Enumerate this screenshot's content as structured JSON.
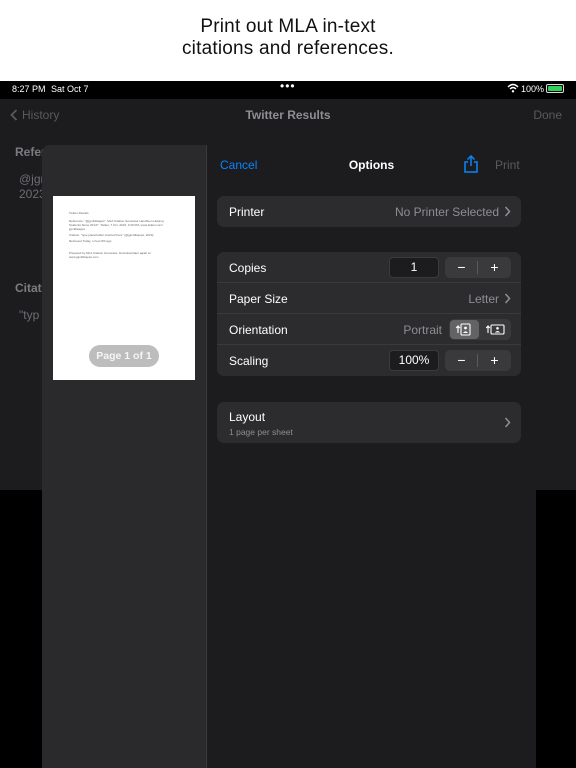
{
  "promo": {
    "line1": "Print out MLA in-text",
    "line2": "citations and references."
  },
  "status_bar": {
    "time": "8:27 PM",
    "date": "Sat Oct 7",
    "battery": "100%"
  },
  "app_nav": {
    "back": "History",
    "title": "Twitter Results",
    "done": "Done"
  },
  "background": {
    "section1_heading": "Refer",
    "section1_line1": "@jgr",
    "section1_line2": "2023",
    "section2_heading": "Citat",
    "section2_line1": "\"typ"
  },
  "preview": {
    "page_lines": [
      "Twitter Results",
      "Reference: \"@jgmldlsapps\". MLA Citation Generator Has Been Helping",
      "Students Since 2014!\". Twitter, 7 Oct. 2023, 3:30 PM, www.twitter.com/",
      "jgmldlsapps.",
      "Citation: \"type placeholder inserted here\" (@jgmldlsapps, 2023).",
      "Retrieved Today, 1 hour 8th ago",
      "Prepared by MLA Citation Generator. Download later again at",
      "www.jgmldlsapps.com"
    ],
    "page_badge": "Page 1 of 1"
  },
  "options": {
    "cancel": "Cancel",
    "title": "Options",
    "print": "Print",
    "printer_label": "Printer",
    "printer_value": "No Printer Selected",
    "copies_label": "Copies",
    "copies_value": "1",
    "paper_label": "Paper Size",
    "paper_value": "Letter",
    "orientation_label": "Orientation",
    "orientation_value": "Portrait",
    "scaling_label": "Scaling",
    "scaling_value": "100%",
    "layout_label": "Layout",
    "layout_sub": "1 page per sheet",
    "minus": "−",
    "plus": "+"
  },
  "colors": {
    "accent": "#0a84ff",
    "battery": "#30d158"
  }
}
